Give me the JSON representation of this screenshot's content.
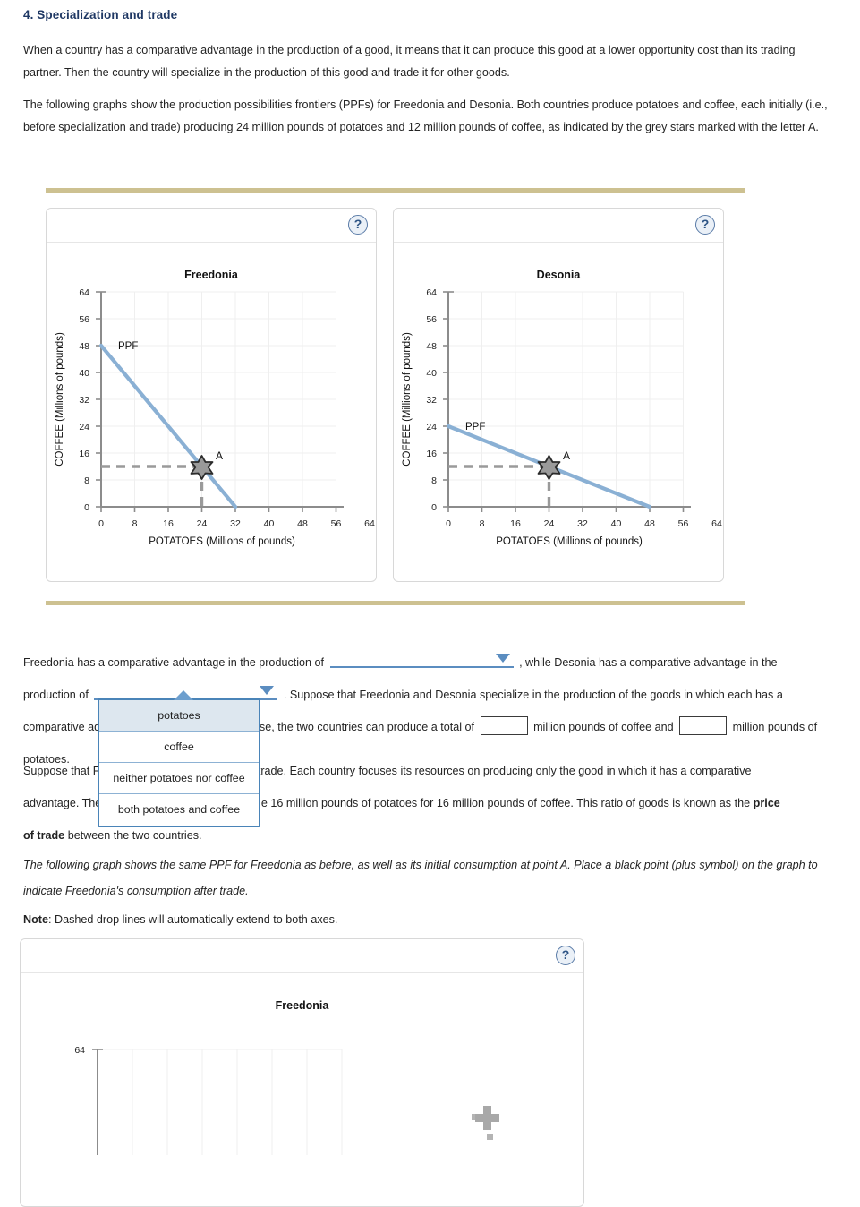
{
  "page": {
    "section_title": "4. Specialization and trade",
    "paragraph_1": "When a country has a comparative advantage in the production of a good, it means that it can produce this good at a lower opportunity cost than its trading partner. Then the country will specialize in the production of this good and trade it for other goods.",
    "paragraph_2": "The following graphs show the production possibilities frontiers (PPFs) for Freedonia and Desonia. Both countries produce potatoes and coffee, each initially (i.e., before specialization and trade) producing 24 million pounds of potatoes and 12 million pounds of coffee, as indicated by the grey stars marked with the letter A."
  },
  "help_icon": {
    "glyph": "?",
    "name": "help-icon"
  },
  "question": {
    "line1_a": "Freedonia has a comparative advantage in the production of",
    "line1_b": ", while Desonia has a comparative advantage in the",
    "line2_a": "production of",
    "line2_b": ". Suppose that Freedonia and Desonia specialize in the production of the goods in which each has a",
    "line3_a": "comparative advantage in production. In this case, the two countries can produce a total of",
    "line3_b": "million pounds of coffee and",
    "line3_c": "million pounds of",
    "line4": "potatoes.",
    "dropdown1_value": "",
    "dropdown2_value": "",
    "coffee_total_value": "",
    "potatoes_total_value": ""
  },
  "dropdown_options": [
    "potatoes",
    "coffee",
    "neither potatoes nor coffee",
    "both potatoes and coffee"
  ],
  "dropdown_selected_index": 0,
  "paragraph_trade": {
    "part_a": "Suppose that Freedonia and Desonia agree",
    "part_b": "to trade. Each country focuses its resources on producing only the good in which it has a comparative",
    "part_c": "advantage. The two countries decide to trade",
    "part_d": "the 16 million pounds of potatoes for 16 million pounds of coffee. This ratio of goods is known as the",
    "bold_1": "price",
    "bold_2": "of trade",
    "part_e": "between the two countries."
  },
  "italic_note": "The following graph shows the same PPF for Freedonia as before, as well as its initial consumption at point A. Place a black point (plus symbol) on the graph to indicate Freedonia's consumption after trade.",
  "note": {
    "label": "Note",
    "text": ": Dashed drop lines will automatically extend to both axes."
  },
  "colors": {
    "title": "#1f3864",
    "ppf_line": "#8ab0d4",
    "dashed_guide": "#9a9a9a",
    "star_fill": "#9a9a9a",
    "star_stroke": "#2b2b2b",
    "divider": "#cdc191",
    "dropdown_border": "#4a84b8",
    "axis": "#8c8c8c",
    "grid": "#eeeeee"
  },
  "chart_data": [
    {
      "type": "line",
      "name": "freedonia-ppf-chart",
      "title": "Freedonia",
      "xlabel": "POTATOES (Millions of pounds)",
      "ylabel": "COFFEE (Millions of pounds)",
      "xlim": [
        0,
        64
      ],
      "ylim": [
        0,
        64
      ],
      "xticks": [
        0,
        8,
        16,
        24,
        32,
        40,
        48,
        56,
        64
      ],
      "yticks": [
        0,
        8,
        16,
        24,
        32,
        40,
        48,
        56,
        64
      ],
      "grid": true,
      "series": [
        {
          "name": "PPF",
          "label": "PPF",
          "x": [
            0,
            32
          ],
          "values": [
            48,
            0
          ],
          "color": "#8ab0d4"
        }
      ],
      "annotations": [
        {
          "label": "A",
          "marker": "grey-star",
          "x": 24,
          "y": 12,
          "drop_lines": true
        }
      ]
    },
    {
      "type": "line",
      "name": "desonia-ppf-chart",
      "title": "Desonia",
      "xlabel": "POTATOES (Millions of pounds)",
      "ylabel": "COFFEE (Millions of pounds)",
      "xlim": [
        0,
        64
      ],
      "ylim": [
        0,
        64
      ],
      "xticks": [
        0,
        8,
        16,
        24,
        32,
        40,
        48,
        56,
        64
      ],
      "yticks": [
        0,
        8,
        16,
        24,
        32,
        40,
        48,
        56,
        64
      ],
      "grid": true,
      "series": [
        {
          "name": "PPF",
          "label": "PPF",
          "x": [
            0,
            48
          ],
          "values": [
            24,
            0
          ],
          "color": "#8ab0d4"
        }
      ],
      "annotations": [
        {
          "label": "A",
          "marker": "grey-star",
          "x": 24,
          "y": 12,
          "drop_lines": true
        }
      ]
    },
    {
      "type": "line",
      "name": "freedonia-interactive-chart",
      "title": "Freedonia",
      "xlabel": "",
      "ylabel": "",
      "ylim": [
        0,
        64
      ],
      "yticks": [
        64
      ],
      "grid": true,
      "series": [],
      "annotations": [
        {
          "label": "",
          "marker": "plus-cursor",
          "x": null,
          "y": null
        }
      ]
    }
  ]
}
